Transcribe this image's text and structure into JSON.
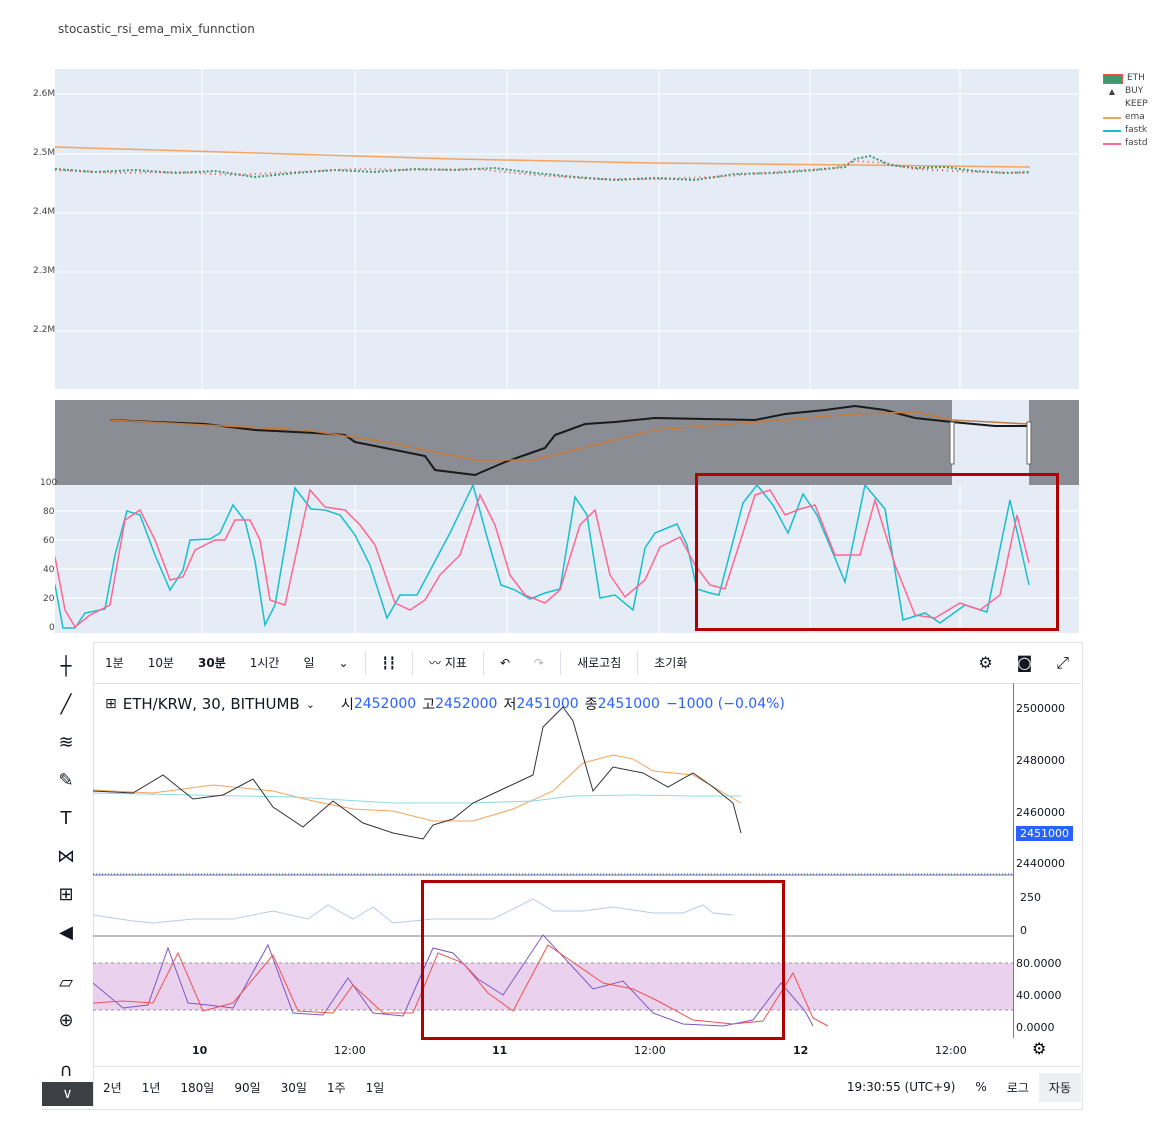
{
  "title": "stocastic_rsi_ema_mix_funnction",
  "main_chart": {
    "yticks": [
      "2.6M",
      "2.5M",
      "2.4M",
      "2.3M",
      "2.2M"
    ],
    "legend": [
      {
        "label": "ETH",
        "color": "#3d9970"
      },
      {
        "label": "BUY",
        "color": "#000000"
      },
      {
        "label": "KEEP",
        "color": "#ffffff"
      },
      {
        "label": "ema",
        "color": "#f4a460"
      },
      {
        "label": "fastk",
        "color": "#17becf"
      },
      {
        "label": "fastd",
        "color": "#ff6692"
      }
    ]
  },
  "stoch_chart": {
    "yticks": [
      "100",
      "80",
      "60",
      "40",
      "20",
      "0"
    ]
  },
  "tv": {
    "intervals": [
      "1분",
      "10분",
      "30분",
      "1시간",
      "일"
    ],
    "indicator_label": "지표",
    "refresh_label": "새로고침",
    "reset_label": "초기화",
    "symbol": "ETH/KRW, 30, BITHUMB",
    "o_label": "시",
    "o_value": "2452000",
    "h_label": "고",
    "h_value": "2452000",
    "l_label": "저",
    "l_value": "2451000",
    "c_label": "종",
    "c_value": "2451000",
    "change": "−1000 (−0.04%)",
    "price_ticks": [
      "2500000",
      "2480000",
      "2460000",
      "2451000",
      "2440000"
    ],
    "volume_ticks": [
      "250",
      "0"
    ],
    "stoch_ticks": [
      "80.0000",
      "40.0000",
      "0.0000"
    ],
    "time_ticks": [
      "10",
      "12:00",
      "11",
      "12:00",
      "12",
      "12:00"
    ],
    "ranges": [
      "2년",
      "1년",
      "180일",
      "90일",
      "30일",
      "1주",
      "1일"
    ],
    "clock": "19:30:55 (UTC+9)",
    "percent_label": "%",
    "log_label": "로그",
    "auto_label": "자동",
    "colors": {
      "up": "#ef5350",
      "down": "#2962ff",
      "accent": "#2962ff"
    }
  }
}
